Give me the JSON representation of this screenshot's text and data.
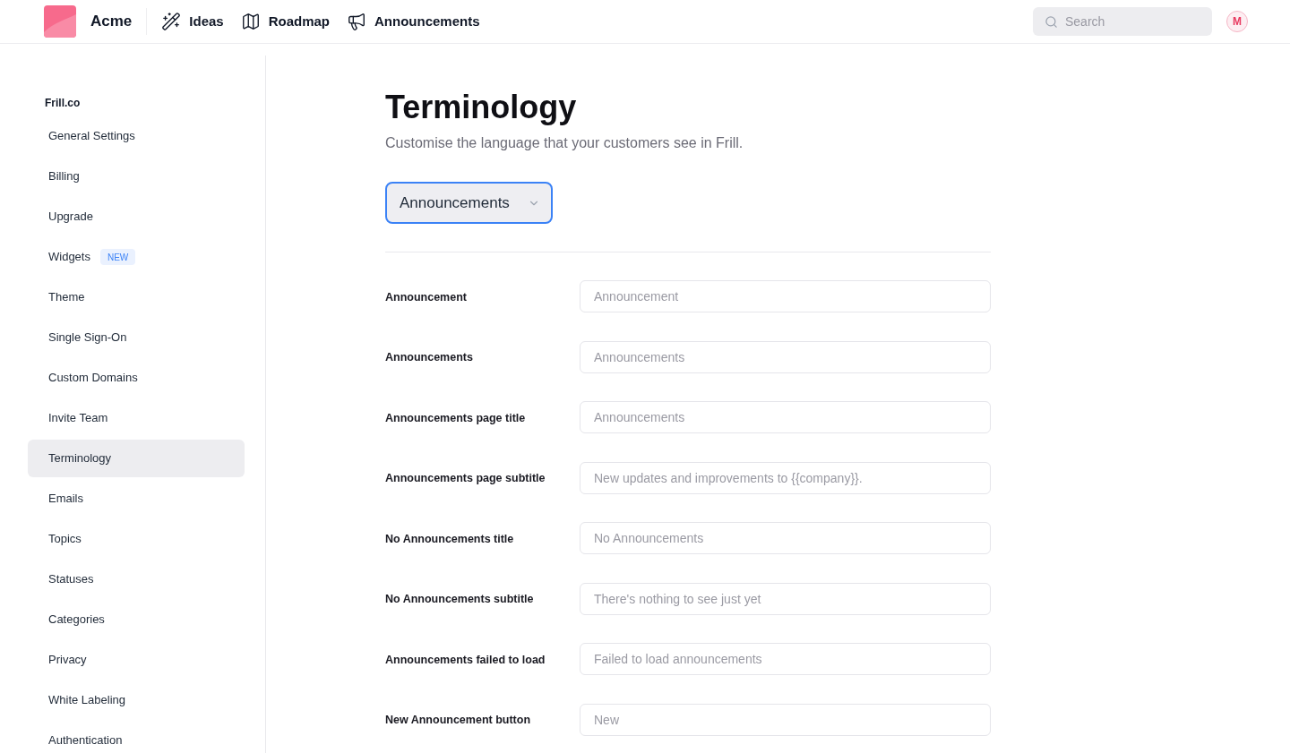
{
  "header": {
    "brand": "Acme",
    "nav": [
      {
        "label": "Ideas"
      },
      {
        "label": "Roadmap"
      },
      {
        "label": "Announcements"
      }
    ],
    "search": {
      "placeholder": "Search"
    },
    "avatar": "M"
  },
  "sidebar": {
    "heading": "Frill.co",
    "items": [
      {
        "label": "General Settings",
        "selected": false
      },
      {
        "label": "Billing",
        "selected": false
      },
      {
        "label": "Upgrade",
        "selected": false
      },
      {
        "label": "Widgets",
        "badge": "NEW",
        "selected": false
      },
      {
        "label": "Theme",
        "selected": false
      },
      {
        "label": "Single Sign-On",
        "selected": false
      },
      {
        "label": "Custom Domains",
        "selected": false
      },
      {
        "label": "Invite Team",
        "selected": false
      },
      {
        "label": "Terminology",
        "selected": true
      },
      {
        "label": "Emails",
        "selected": false
      },
      {
        "label": "Topics",
        "selected": false
      },
      {
        "label": "Statuses",
        "selected": false
      },
      {
        "label": "Categories",
        "selected": false
      },
      {
        "label": "Privacy",
        "selected": false
      },
      {
        "label": "White Labeling",
        "selected": false
      },
      {
        "label": "Authentication",
        "selected": false
      }
    ]
  },
  "main": {
    "title": "Terminology",
    "subtitle": "Customise the language that your customers see in Frill.",
    "section_select": {
      "value": "Announcements"
    },
    "fields": [
      {
        "label": "Announcement",
        "placeholder": "Announcement"
      },
      {
        "label": "Announcements",
        "placeholder": "Announcements"
      },
      {
        "label": "Announcements page title",
        "placeholder": "Announcements"
      },
      {
        "label": "Announcements page subtitle",
        "placeholder": "New updates and improvements to {{company}}."
      },
      {
        "label": "No Announcements title",
        "placeholder": "No Announcements"
      },
      {
        "label": "No Announcements subtitle",
        "placeholder": "There's nothing to see just yet"
      },
      {
        "label": "Announcements failed to load",
        "placeholder": "Failed to load announcements"
      },
      {
        "label": "New Announcement button",
        "placeholder": "New"
      }
    ]
  }
}
